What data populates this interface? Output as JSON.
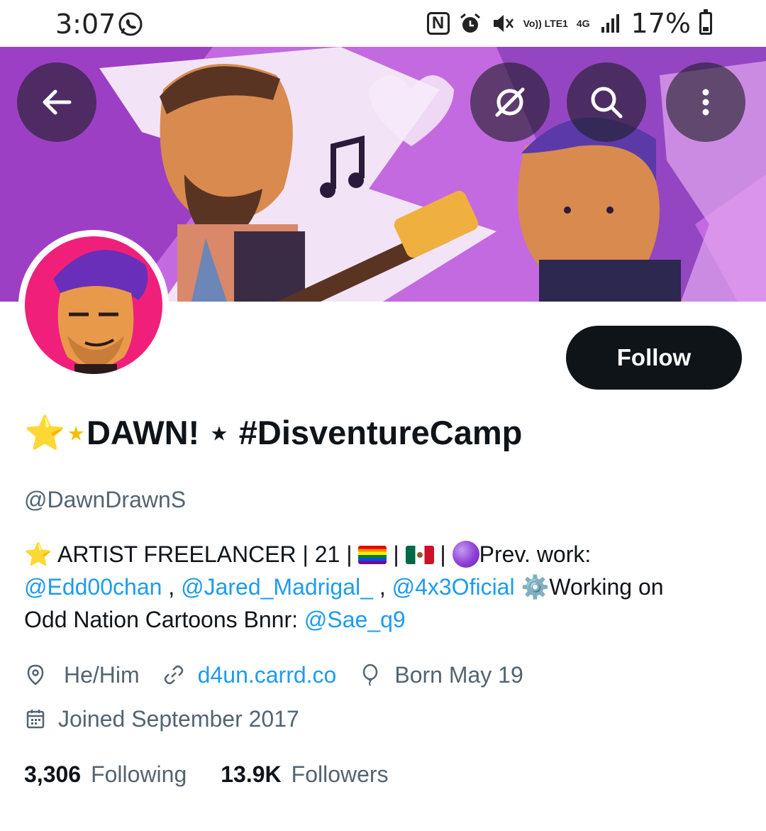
{
  "status_bar": {
    "time": "3:07",
    "battery": "17%",
    "network": "4G",
    "volte": "Vo)) LTE1",
    "icons": [
      "whatsapp-icon",
      "nfc-icon",
      "alarm-icon",
      "mute-icon",
      "volte-icon",
      "signal-icon",
      "battery-icon"
    ]
  },
  "header": {
    "buttons": [
      "back-arrow-icon",
      "grok-icon",
      "search-icon",
      "more-vertical-icon"
    ]
  },
  "profile": {
    "follow_label": "Follow",
    "display_name_prefix": "⭐⋆",
    "display_name_main": "DAWN! ⋆ #DisventureCamp",
    "handle": "@DawnDrawnS",
    "bio": {
      "line1_a": "⭐ ARTIST FREELANCER | 21 | ",
      "line1_b": " | ",
      "line1_c": " | ",
      "line1_d": "Prev. work:",
      "mention1": "@Edd00chan",
      "sep1": " , ",
      "mention2": "@Jared_Madrigal_",
      "sep2": " , ",
      "mention3": "@4x3Oficial",
      "gear": " ⚙️",
      "working": "Working on",
      "line3": "Odd Nation Cartoons  Bnnr: ",
      "mention4": "@Sae_q9"
    },
    "pronouns": "He/Him",
    "website": "d4un.carrd.co",
    "birthday": "Born May 19",
    "joined": "Joined September 2017",
    "following_count": "3,306",
    "following_label": "Following",
    "followers_count": "13.9K",
    "followers_label": "Followers"
  },
  "colors": {
    "accent": "#1d9bf0",
    "follow_bg": "#0f1419",
    "secondary_text": "#536471",
    "banner_purple": "#b85ad8"
  }
}
